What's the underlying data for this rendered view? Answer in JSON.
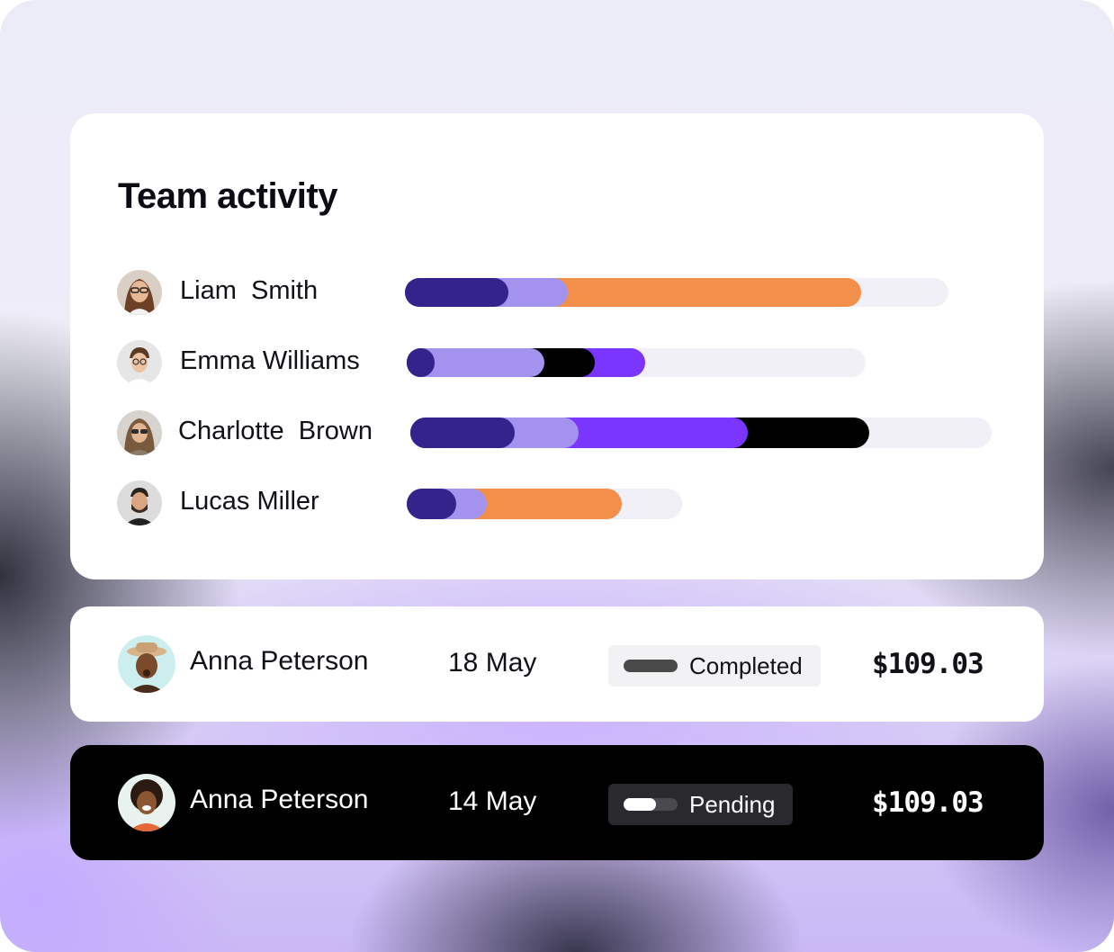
{
  "team_activity": {
    "title": "Team activity",
    "colors": {
      "indigo": "#33238a",
      "lavender": "#a393ef",
      "orange": "#f2904b",
      "black": "#000000",
      "violet": "#7a35ff",
      "track": "#f0f0f6"
    },
    "members": [
      {
        "name": "Liam  Smith",
        "avatar": "woman-with-glasses-avatar",
        "total_share": 0.84,
        "segments": [
          {
            "color": "indigo",
            "share": 0.19
          },
          {
            "color": "lavender",
            "share": 0.11
          },
          {
            "color": "orange",
            "share": 0.54
          }
        ]
      },
      {
        "name": "Emma Williams",
        "avatar": "young-man-avatar",
        "total_share": 0.52,
        "segments": [
          {
            "color": "indigo",
            "share": 0.06
          },
          {
            "color": "lavender",
            "share": 0.24
          },
          {
            "color": "black",
            "share": 0.11
          },
          {
            "color": "violet",
            "share": 0.11
          }
        ]
      },
      {
        "name": "Charlotte  Brown",
        "avatar": "woman-with-sunglasses-avatar",
        "total_share": 0.79,
        "segments": [
          {
            "color": "indigo",
            "share": 0.18
          },
          {
            "color": "lavender",
            "share": 0.11
          },
          {
            "color": "violet",
            "share": 0.29
          },
          {
            "color": "black",
            "share": 0.21
          }
        ]
      },
      {
        "name": "Lucas Miller",
        "avatar": "bearded-man-avatar",
        "total_share": 0.78,
        "segments": [
          {
            "color": "indigo",
            "share": 0.18
          },
          {
            "color": "lavender",
            "share": 0.11
          },
          {
            "color": "orange",
            "share": 0.49
          }
        ]
      }
    ]
  },
  "transactions": [
    {
      "name": "Anna Peterson",
      "date": "18 May",
      "status": "Completed",
      "amount": "$109.03",
      "avatar": "man-with-hat-avatar",
      "theme": "light"
    },
    {
      "name": "Anna Peterson",
      "date": "14 May",
      "status": "Pending",
      "amount": "$109.03",
      "avatar": "smiling-woman-avatar",
      "theme": "dark"
    }
  ]
}
